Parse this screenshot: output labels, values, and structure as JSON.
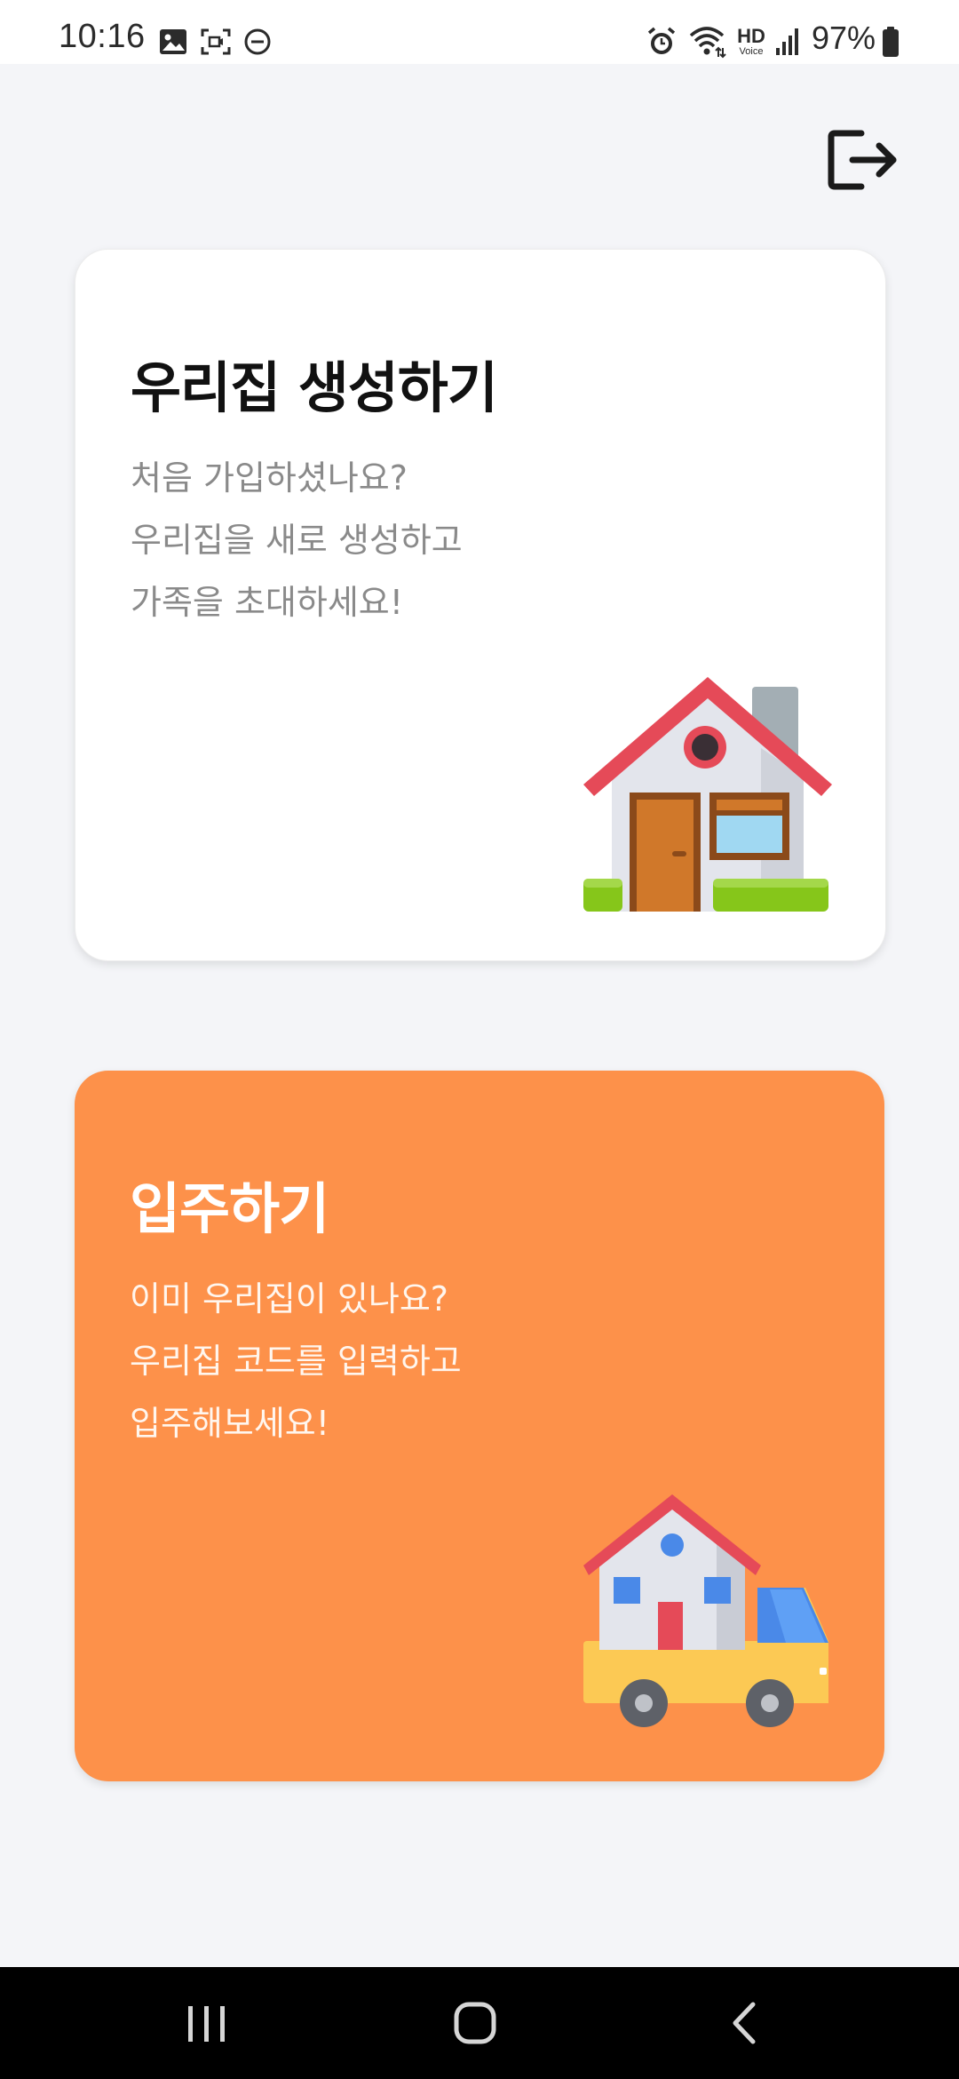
{
  "status_bar": {
    "time": "10:16",
    "battery": "97%",
    "left_icons": [
      "image-icon",
      "screen-capture-icon",
      "do-not-disturb-icon"
    ],
    "right_icons": [
      "alarm-icon",
      "wifi-icon",
      "hd-voice-icon",
      "signal-icon",
      "battery-icon"
    ],
    "hd_label": "HD",
    "voice_label": "Voice"
  },
  "header": {
    "logout_icon": "logout-icon"
  },
  "cards": {
    "create": {
      "title": "우리집 생성하기",
      "lines": [
        "처음 가입하셨나요?",
        "우리집을 새로 생성하고",
        "가족을 초대하세요!"
      ],
      "illustration": "house-icon",
      "background": "#ffffff"
    },
    "join": {
      "title": "입주하기",
      "lines": [
        "이미 우리집이 있나요?",
        "우리집 코드를 입력하고",
        "입주해보세요!"
      ],
      "illustration": "moving-truck-icon",
      "background": "#fd914a"
    }
  },
  "nav_bar": {
    "recent_icon": "recent-apps-icon",
    "home_icon": "home-icon",
    "back_icon": "back-icon"
  },
  "colors": {
    "accent": "#fd914a",
    "page_bg": "#f4f5f8"
  }
}
